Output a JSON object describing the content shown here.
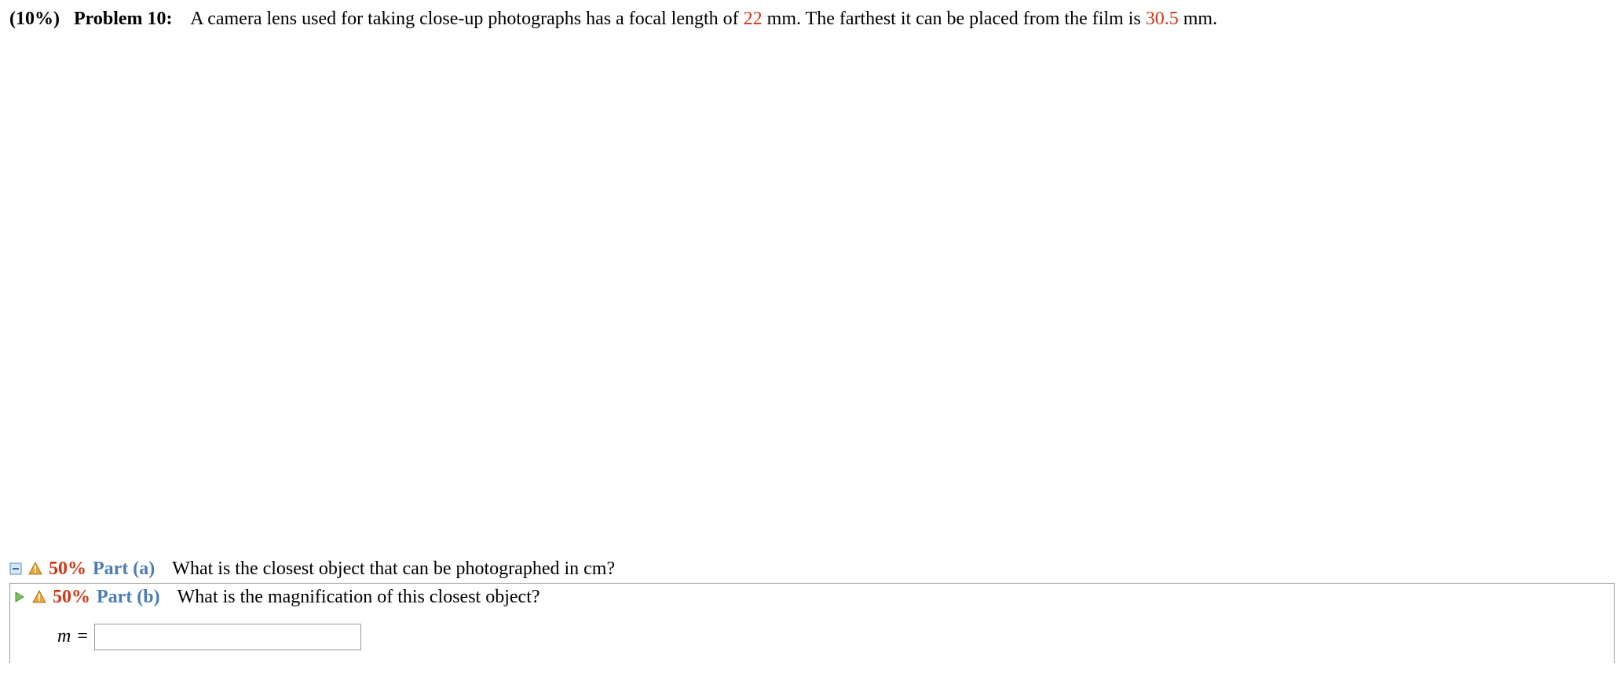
{
  "problem": {
    "weight": "(10%)",
    "label": "Problem 10:",
    "text_prefix": "A camera lens used for taking close-up photographs has a focal length of ",
    "val1": "22",
    "text_mid": " mm. The farthest it can be placed from the film is ",
    "val2": "30.5",
    "text_suffix": " mm."
  },
  "parts": {
    "a": {
      "weight": "50%",
      "label": "Part (a)",
      "text": "What is the closest object that can be photographed in cm?"
    },
    "b": {
      "weight": "50%",
      "label": "Part (b)",
      "text": "What is the magnification of this closest object?"
    }
  },
  "answer": {
    "var": "m",
    "equals": "=",
    "value": ""
  }
}
